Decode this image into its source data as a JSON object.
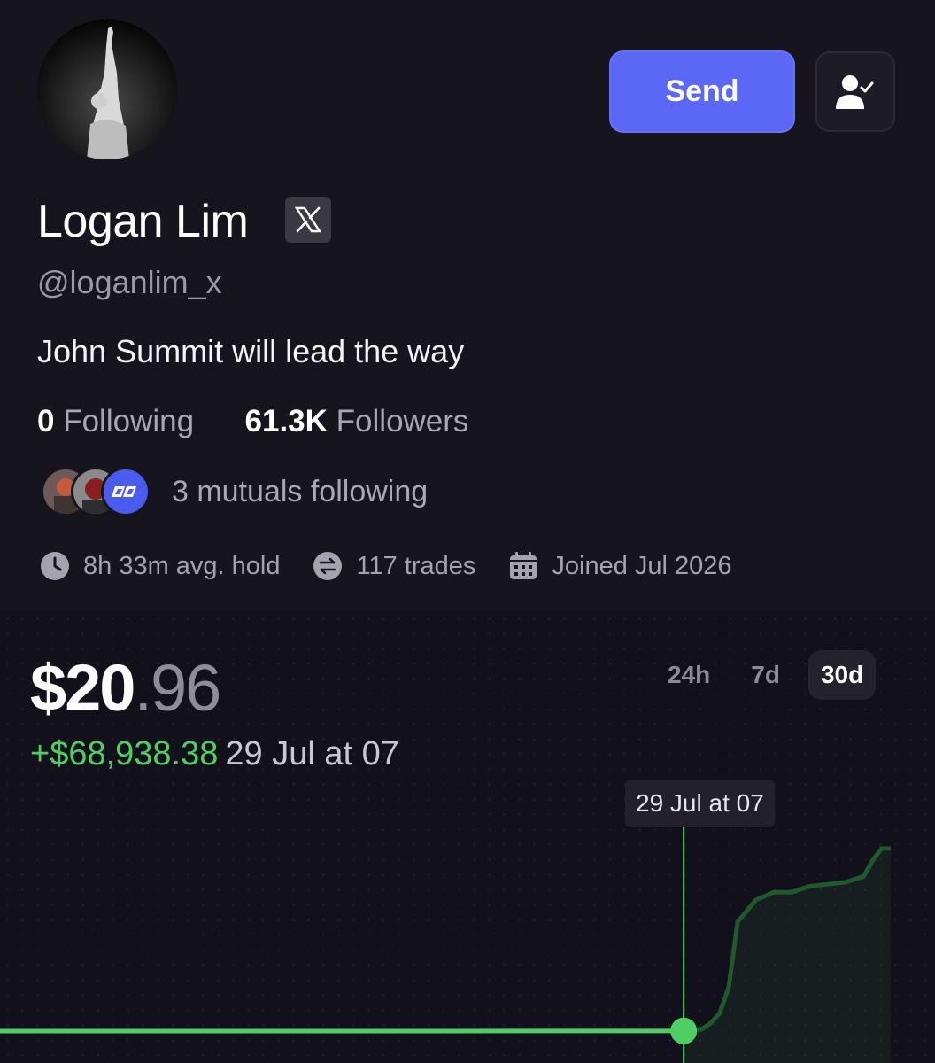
{
  "profile": {
    "name": "Logan Lim",
    "handle": "@loganlim_x",
    "bio": "John Summit will lead the way",
    "following_count": "0",
    "following_label": "Following",
    "followers_count": "61.3K",
    "followers_label": "Followers",
    "mutuals_text": "3 mutuals following",
    "avg_hold": "8h 33m avg. hold",
    "trades": "117 trades",
    "joined": "Joined Jul 2026",
    "verified_badge_icon": "x-logo-icon"
  },
  "actions": {
    "send_label": "Send",
    "follow_icon": "user-check-icon"
  },
  "portfolio": {
    "value_whole": "$20",
    "value_decimal": ".96",
    "change": "+$68,938.38",
    "change_time": "29 Jul at 07",
    "tooltip": "29 Jul at 07",
    "tabs": [
      "24h",
      "7d",
      "30d"
    ],
    "active_tab": "30d"
  },
  "colors": {
    "background": "#16151e",
    "chart_background": "#12111b",
    "accent_blue": "#5a68f5",
    "positive_green": "#4fcf63",
    "muted_text": "#a8a7b3"
  },
  "chart_data": {
    "type": "line",
    "title": "",
    "xlabel": "",
    "ylabel": "",
    "grid": "dotted",
    "x": [
      0,
      0.1,
      0.2,
      0.3,
      0.4,
      0.5,
      0.6,
      0.7,
      0.76,
      0.78,
      0.79,
      0.8,
      0.81,
      0.82,
      0.84,
      0.86,
      0.88,
      0.9,
      0.92,
      0.94,
      0.96,
      0.97,
      0.98,
      0.99
    ],
    "values": [
      0,
      0,
      0,
      0,
      0,
      0,
      0.05,
      0.05,
      0.1,
      1,
      4,
      9,
      22,
      55,
      66,
      70,
      70,
      73,
      74,
      75,
      78,
      86,
      92,
      92
    ],
    "highlight": {
      "x": 0.76,
      "label": "29 Jul at 07"
    }
  }
}
